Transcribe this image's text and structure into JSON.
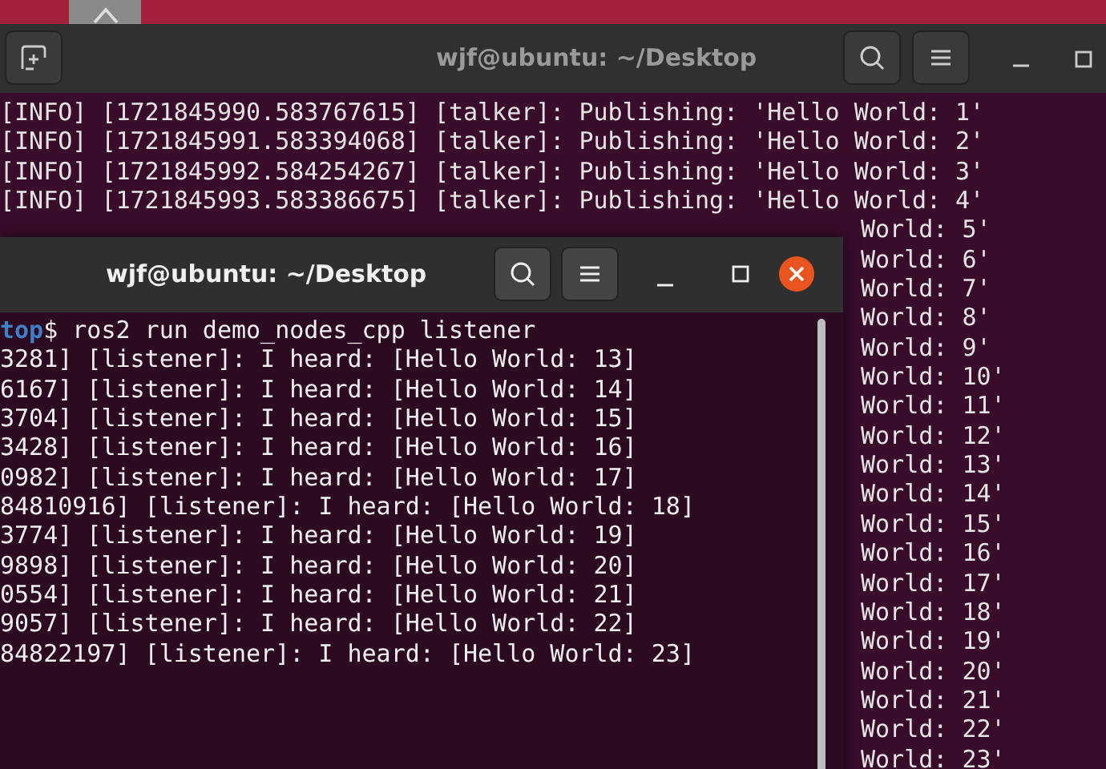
{
  "back_terminal": {
    "title": "wjf@ubuntu: ~/Desktop",
    "lines": [
      "[INFO] [1721845990.583767615] [talker]: Publishing: 'Hello World: 1'",
      "[INFO] [1721845991.583394068] [talker]: Publishing: 'Hello World: 2'",
      "[INFO] [1721845992.584254267] [talker]: Publishing: 'Hello World: 3'",
      "[INFO] [1721845993.583386675] [talker]: Publishing: 'Hello World: 4'"
    ],
    "visible_tails": [
      "World: 5'",
      "World: 6'",
      "World: 7'",
      "World: 8'",
      "World: 9'",
      "World: 10'",
      "World: 11'",
      "World: 12'",
      "World: 13'",
      "World: 14'",
      "World: 15'",
      "World: 16'",
      "World: 17'",
      "World: 18'",
      "World: 19'",
      "World: 20'",
      "World: 21'",
      "World: 22'",
      "World: 23'"
    ]
  },
  "front_terminal": {
    "title": "wjf@ubuntu: ~/Desktop",
    "prompt": {
      "path": "top",
      "command": "$ ros2 run demo_nodes_cpp listener"
    },
    "lines": [
      "3281] [listener]: I heard: [Hello World: 13]",
      "6167] [listener]: I heard: [Hello World: 14]",
      "3704] [listener]: I heard: [Hello World: 15]",
      "3428] [listener]: I heard: [Hello World: 16]",
      "0982] [listener]: I heard: [Hello World: 17]",
      "84810916] [listener]: I heard: [Hello World: 18]",
      "3774] [listener]: I heard: [Hello World: 19]",
      "9898] [listener]: I heard: [Hello World: 20]",
      "0554] [listener]: I heard: [Hello World: 21]",
      "9057] [listener]: I heard: [Hello World: 22]",
      "84822197] [listener]: I heard: [Hello World: 23]"
    ]
  }
}
